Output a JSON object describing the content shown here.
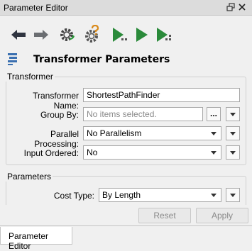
{
  "window": {
    "title": "Parameter Editor"
  },
  "toolbar": {
    "icons": [
      "back-arrow-icon",
      "forward-arrow-icon",
      "gear-refresh-icon",
      "help-gear-icon",
      "run-to-this-icon",
      "run-icon",
      "run-from-this-icon"
    ]
  },
  "header": {
    "title": "Transformer Parameters"
  },
  "transformer_group": {
    "title": "Transformer",
    "name_label": "Transformer Name:",
    "name_value": "ShortestPathFinder",
    "group_by_label": "Group By:",
    "group_by_placeholder": "No items selected.",
    "group_by_button": "...",
    "parallel_label": "Parallel Processing:",
    "parallel_value": "No Parallelism",
    "input_ordered_label": "Input Ordered:",
    "input_ordered_value": "No"
  },
  "parameters_group": {
    "title": "Parameters",
    "cost_type_label": "Cost Type:",
    "cost_type_value": "By Length"
  },
  "actions": {
    "reset_label": "Reset",
    "apply_label": "Apply"
  },
  "tabs": {
    "active_label": "Parameter Editor"
  }
}
